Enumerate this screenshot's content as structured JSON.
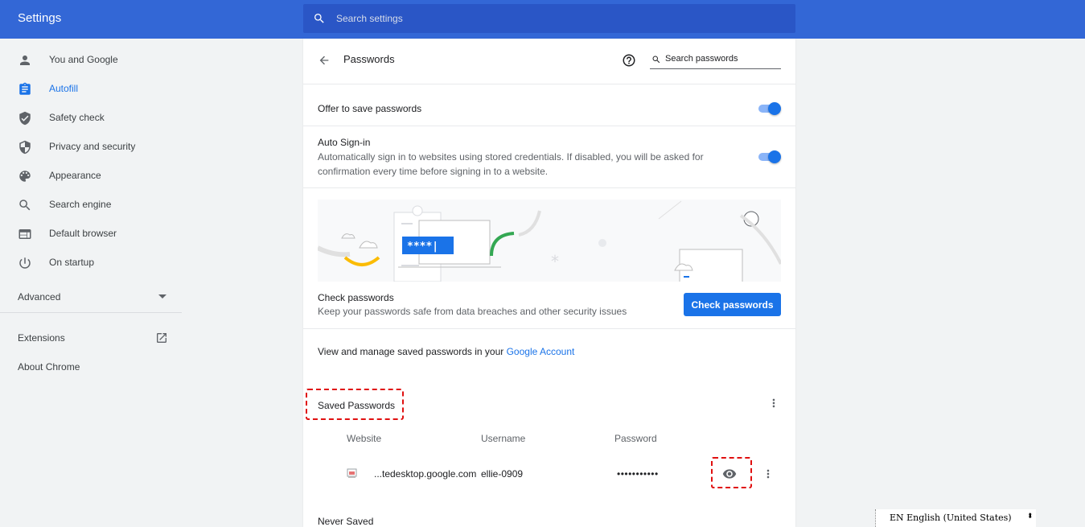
{
  "header": {
    "title": "Settings",
    "search_placeholder": "Search settings"
  },
  "sidebar": {
    "items": [
      {
        "label": "You and Google",
        "icon": "person-icon"
      },
      {
        "label": "Autofill",
        "icon": "clipboard-icon",
        "active": true
      },
      {
        "label": "Safety check",
        "icon": "shield-check-icon"
      },
      {
        "label": "Privacy and security",
        "icon": "shield-half-icon"
      },
      {
        "label": "Appearance",
        "icon": "palette-icon"
      },
      {
        "label": "Search engine",
        "icon": "search-icon"
      },
      {
        "label": "Default browser",
        "icon": "browser-window-icon"
      },
      {
        "label": "On startup",
        "icon": "power-icon"
      }
    ],
    "advanced_label": "Advanced",
    "extensions_label": "Extensions",
    "about_label": "About Chrome"
  },
  "passwords": {
    "title": "Passwords",
    "search_placeholder": "Search passwords",
    "offer_to_save": {
      "label": "Offer to save passwords",
      "enabled": true
    },
    "auto_signin": {
      "label": "Auto Sign-in",
      "description_line1": "Automatically sign in to websites using stored credentials. If disabled, you will be asked for",
      "description_line2": "confirmation every time before signing in to a website.",
      "enabled": true
    },
    "illustration_text": "****|",
    "check": {
      "title": "Check passwords",
      "description": "Keep your passwords safe from data breaches and other security issues",
      "button_label": "Check passwords"
    },
    "manage_text": "View and manage saved passwords in your ",
    "manage_link": "Google Account",
    "saved_title": "Saved Passwords",
    "columns": {
      "website": "Website",
      "username": "Username",
      "password": "Password"
    },
    "rows": [
      {
        "website": "...tedesktop.google.com",
        "username": "ellie-0909",
        "password": "•••••••••••"
      }
    ],
    "never_saved_title": "Never Saved"
  },
  "langbar": {
    "text": "EN English (United States)"
  },
  "colors": {
    "header_blue": "#3367d6",
    "accent": "#1a73e8",
    "highlight_red": "#e01010"
  }
}
